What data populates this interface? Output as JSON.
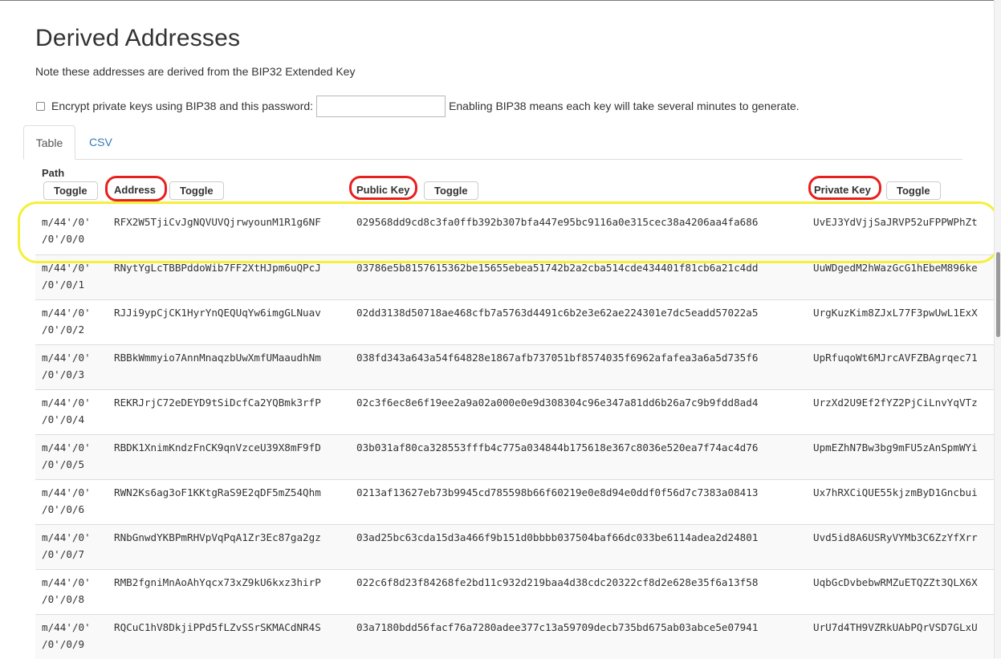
{
  "heading": "Derived Addresses",
  "note": "Note these addresses are derived from the BIP32 Extended Key",
  "bip38": {
    "checkbox_label": "Encrypt private keys using BIP38 and this password:",
    "password_value": "",
    "hint": "Enabling BIP38 means each key will take several minutes to generate."
  },
  "tabs": [
    "Table",
    "CSV"
  ],
  "columns": {
    "path": "Path",
    "address": "Address",
    "public_key": "Public Key",
    "private_key": "Private Key",
    "toggle": "Toggle"
  },
  "annotation_colors": {
    "circle": "#e8201c",
    "highlight": "#f5f03a"
  },
  "rows": [
    {
      "path_line1": "m/44'/0'",
      "path_line2": "/0'/0/0",
      "address": "RFX2W5TjiCvJgNQVUVQjrwyounM1R1g6NF",
      "public_key": "029568dd9cd8c3fa0ffb392b307bfa447e95bc9116a0e315cec38a4206aa4fa686",
      "private_key": "UvEJ3YdVjjSaJRVP52uFPPWPhZt"
    },
    {
      "path_line1": "m/44'/0'",
      "path_line2": "/0'/0/1",
      "address": "RNytYgLcTBBPddoWib7FF2XtHJpm6uQPcJ",
      "public_key": "03786e5b8157615362be15655ebea51742b2a2cba514cde434401f81cb6a21c4dd",
      "private_key": "UuWDgedM2hWazGcG1hEbeM896ke"
    },
    {
      "path_line1": "m/44'/0'",
      "path_line2": "/0'/0/2",
      "address": "RJJi9ypCjCK1HyrYnQEQUqYw6imgGLNuav",
      "public_key": "02dd3138d50718ae468cfb7a5763d4491c6b2e3e62ae224301e7dc5eadd57022a5",
      "private_key": "UrgKuzKim8ZJxL77F3pwUwL1ExX"
    },
    {
      "path_line1": "m/44'/0'",
      "path_line2": "/0'/0/3",
      "address": "RBBkWmmyio7AnnMnaqzbUwXmfUMaaudhNm",
      "public_key": "038fd343a643a54f64828e1867afb737051bf8574035f6962afafea3a6a5d735f6",
      "private_key": "UpRfuqoWt6MJrcAVFZBAgrqec71"
    },
    {
      "path_line1": "m/44'/0'",
      "path_line2": "/0'/0/4",
      "address": "REKRJrjC72eDEYD9tSiDcfCa2YQBmk3rfP",
      "public_key": "02c3f6ec8e6f19ee2a9a02a000e0e9d308304c96e347a81dd6b26a7c9b9fdd8ad4",
      "private_key": "UrzXd2U9Ef2fYZ2PjCiLnvYqVTz"
    },
    {
      "path_line1": "m/44'/0'",
      "path_line2": "/0'/0/5",
      "address": "RBDK1XnimKndzFnCK9qnVzceU39X8mF9fD",
      "public_key": "03b031af80ca328553fffb4c775a034844b175618e367c8036e520ea7f74ac4d76",
      "private_key": "UpmEZhN7Bw3bg9mFU5zAnSpmWYi"
    },
    {
      "path_line1": "m/44'/0'",
      "path_line2": "/0'/0/6",
      "address": "RWN2Ks6ag3oF1KKtgRaS9E2qDF5mZ54Qhm",
      "public_key": "0213af13627eb73b9945cd785598b66f60219e0e8d94e0ddf0f56d7c7383a08413",
      "private_key": "Ux7hRXCiQUE55kjzmByD1Gncbui"
    },
    {
      "path_line1": "m/44'/0'",
      "path_line2": "/0'/0/7",
      "address": "RNbGnwdYKBPmRHVpVqPqA1Zr3Ec87ga2gz",
      "public_key": "03ad25bc63cda15d3a466f9b151d0bbbb037504baf66dc033be6114adea2d24801",
      "private_key": "Uvd5id8A6USRyVYMb3C6ZzYfXrr"
    },
    {
      "path_line1": "m/44'/0'",
      "path_line2": "/0'/0/8",
      "address": "RMB2fgniMnAoAhYqcx73xZ9kU6kxz3hirP",
      "public_key": "022c6f8d23f84268fe2bd11c932d219baa4d38cdc20322cf8d2e628e35f6a13f58",
      "private_key": "UqbGcDvbebwRMZuETQZZt3QLX6X"
    },
    {
      "path_line1": "m/44'/0'",
      "path_line2": "/0'/0/9",
      "address": "RQCuC1hV8DkjiPPd5fLZvSSrSKMACdNR4S",
      "public_key": "03a7180bdd56facf76a7280adee377c13a59709decb735bd675ab03abce5e07941",
      "private_key": "UrU7d4TH9VZRkUAbPQrVSD7GLxU"
    }
  ]
}
